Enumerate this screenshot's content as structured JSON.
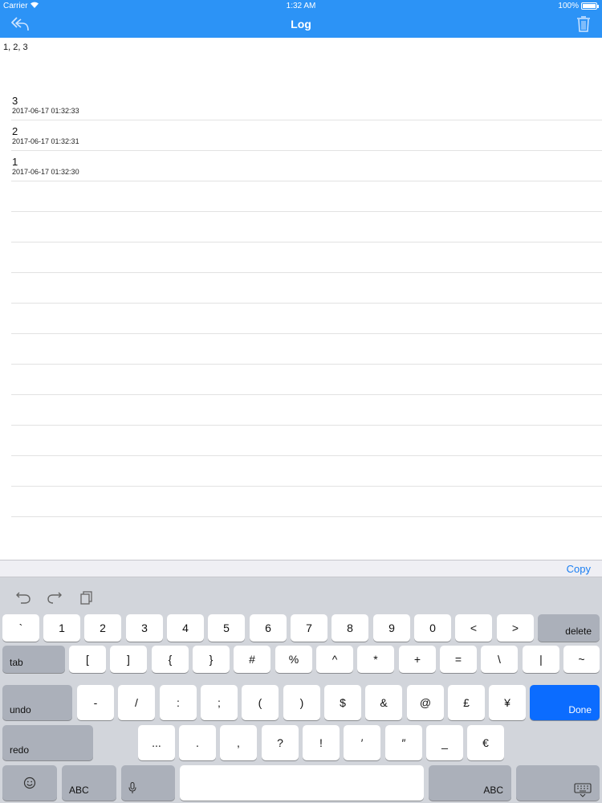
{
  "status_bar": {
    "carrier": "Carrier",
    "time": "1:32 AM",
    "battery": "100%"
  },
  "nav": {
    "title": "Log",
    "back_icon": "reply-arrow-icon",
    "trash_icon": "trash-icon"
  },
  "log_summary": "1, 2, 3",
  "entries": [
    {
      "value": "3",
      "timestamp": "2017-06-17 01:32:33"
    },
    {
      "value": "2",
      "timestamp": "2017-06-17 01:32:31"
    },
    {
      "value": "1",
      "timestamp": "2017-06-17 01:32:30"
    }
  ],
  "keyboard": {
    "copy_label": "Copy",
    "row1": [
      "`",
      "1",
      "2",
      "3",
      "4",
      "5",
      "6",
      "7",
      "8",
      "9",
      "0",
      "<",
      ">"
    ],
    "row1_delete": "delete",
    "row2_tab": "tab",
    "row2": [
      "[",
      "]",
      "{",
      "}",
      "#",
      "%",
      "^",
      "*",
      "+",
      "=",
      "\\",
      "|",
      "~"
    ],
    "row3_undo": "undo",
    "row3": [
      "-",
      "/",
      ":",
      ";",
      "(",
      ")",
      "$",
      "&",
      "@",
      "£",
      "¥"
    ],
    "row3_done": "Done",
    "row4_redo": "redo",
    "row4": [
      "...",
      ".",
      ",",
      "?",
      "!",
      "′",
      "″",
      "_",
      "€"
    ],
    "abc_left": "ABC",
    "abc_right": "ABC"
  },
  "colors": {
    "nav_blue": "#2c93f6",
    "done_blue": "#0b6cff",
    "copy_blue": "#1a7ef2"
  }
}
